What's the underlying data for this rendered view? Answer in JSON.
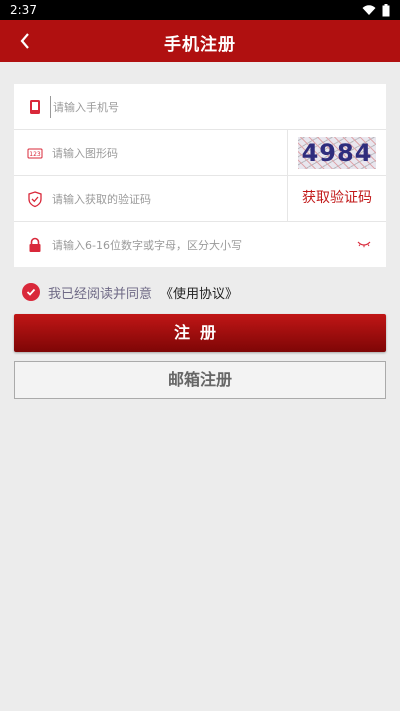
{
  "status_bar": {
    "time": "2:37"
  },
  "header": {
    "title": "手机注册"
  },
  "form": {
    "phone_placeholder": "请输入手机号",
    "captcha_placeholder": "请输入图形码",
    "captcha_text": "4984",
    "sms_placeholder": "请输入获取的验证码",
    "sms_button": "获取验证码",
    "password_placeholder": "请输入6-16位数字或字母，区分大小写"
  },
  "agreement": {
    "text": "我已经阅读并同意",
    "link": "《使用协议》",
    "checked": true
  },
  "buttons": {
    "register": "注册",
    "email_register": "邮箱注册"
  },
  "colors": {
    "brand": "#b01010",
    "accent": "#d9283a"
  }
}
